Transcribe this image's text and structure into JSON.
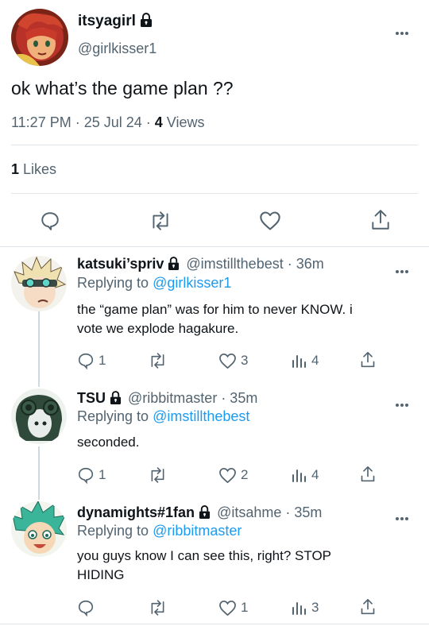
{
  "main_tweet": {
    "display_name": "itsyagirl",
    "handle": "@girlkisser1",
    "text": "ok what’s the game plan ??",
    "time": "11:27 PM · 25 Jul 24 · ",
    "views_count": "4",
    "views_label": " Views",
    "likes_count": "1",
    "likes_label": " Likes"
  },
  "replies": [
    {
      "display_name": "katsuki’spriv",
      "handle_time": "@imstillthebest · 36m",
      "replying_prefix": "Replying to ",
      "replying_to": "@girlkisser1",
      "text_line1": "the “game plan” was for him to never KNOW. i",
      "text_line2": "vote we explode hagakure.",
      "reply_count": "1",
      "retweet_count": "",
      "like_count": "3",
      "views_count": "4"
    },
    {
      "display_name": "TSU",
      "handle_time": "@ribbitmaster · 35m",
      "replying_prefix": "Replying to ",
      "replying_to": "@imstillthebest",
      "text_line1": "seconded.",
      "reply_count": "1",
      "retweet_count": "",
      "like_count": "2",
      "views_count": "4"
    },
    {
      "display_name": "dynamights#1fan",
      "handle_time": "@itsahme · 35m",
      "replying_prefix": "Replying to ",
      "replying_to": "@ribbitmaster",
      "text_line1": "you guys know I can see this, right? STOP",
      "text_line2": "HIDING",
      "reply_count": "",
      "retweet_count": "",
      "like_count": "1",
      "views_count": "3"
    }
  ],
  "colors": {
    "link": "#1d9bf0",
    "muted": "#536471",
    "text": "#0f1419",
    "divider": "#e1e6ea"
  }
}
